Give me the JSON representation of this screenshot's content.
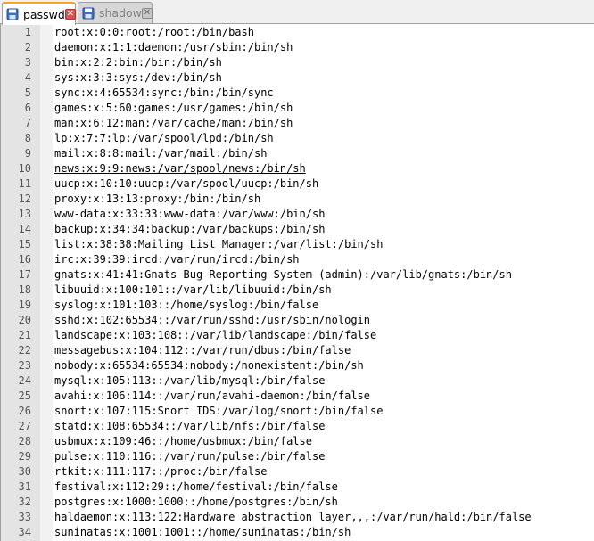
{
  "tabs": [
    {
      "label": "passwd",
      "active": true,
      "icon": "file-saved-icon"
    },
    {
      "label": "shadow",
      "active": false,
      "icon": "file-saved-icon"
    }
  ],
  "close_glyph": "✕",
  "colors": {
    "active_tab_accent": "#f5a623",
    "close_active": "#e05050",
    "gutter": "#e4e4e4",
    "text": "#000000"
  },
  "lines": [
    {
      "n": "1",
      "text": "root:x:0:0:root:/root:/bin/bash"
    },
    {
      "n": "2",
      "text": "daemon:x:1:1:daemon:/usr/sbin:/bin/sh"
    },
    {
      "n": "3",
      "text": "bin:x:2:2:bin:/bin:/bin/sh"
    },
    {
      "n": "4",
      "text": "sys:x:3:3:sys:/dev:/bin/sh"
    },
    {
      "n": "5",
      "text": "sync:x:4:65534:sync:/bin:/bin/sync"
    },
    {
      "n": "6",
      "text": "games:x:5:60:games:/usr/games:/bin/sh"
    },
    {
      "n": "7",
      "text": "man:x:6:12:man:/var/cache/man:/bin/sh"
    },
    {
      "n": "8",
      "text": "lp:x:7:7:lp:/var/spool/lpd:/bin/sh"
    },
    {
      "n": "9",
      "text": "mail:x:8:8:mail:/var/mail:/bin/sh"
    },
    {
      "n": "10",
      "text": "news:x:9:9:news:/var/spool/news:/bin/sh"
    },
    {
      "n": "11",
      "text": "uucp:x:10:10:uucp:/var/spool/uucp:/bin/sh"
    },
    {
      "n": "12",
      "text": "proxy:x:13:13:proxy:/bin:/bin/sh"
    },
    {
      "n": "13",
      "text": "www-data:x:33:33:www-data:/var/www:/bin/sh"
    },
    {
      "n": "14",
      "text": "backup:x:34:34:backup:/var/backups:/bin/sh"
    },
    {
      "n": "15",
      "text": "list:x:38:38:Mailing List Manager:/var/list:/bin/sh"
    },
    {
      "n": "16",
      "text": "irc:x:39:39:ircd:/var/run/ircd:/bin/sh"
    },
    {
      "n": "17",
      "text": "gnats:x:41:41:Gnats Bug-Reporting System (admin):/var/lib/gnats:/bin/sh"
    },
    {
      "n": "18",
      "text": "libuuid:x:100:101::/var/lib/libuuid:/bin/sh"
    },
    {
      "n": "19",
      "text": "syslog:x:101:103::/home/syslog:/bin/false"
    },
    {
      "n": "20",
      "text": "sshd:x:102:65534::/var/run/sshd:/usr/sbin/nologin"
    },
    {
      "n": "21",
      "text": "landscape:x:103:108::/var/lib/landscape:/bin/false"
    },
    {
      "n": "22",
      "text": "messagebus:x:104:112::/var/run/dbus:/bin/false"
    },
    {
      "n": "23",
      "text": "nobody:x:65534:65534:nobody:/nonexistent:/bin/sh"
    },
    {
      "n": "24",
      "text": "mysql:x:105:113::/var/lib/mysql:/bin/false"
    },
    {
      "n": "25",
      "text": "avahi:x:106:114::/var/run/avahi-daemon:/bin/false"
    },
    {
      "n": "26",
      "text": "snort:x:107:115:Snort IDS:/var/log/snort:/bin/false"
    },
    {
      "n": "27",
      "text": "statd:x:108:65534::/var/lib/nfs:/bin/false"
    },
    {
      "n": "28",
      "text": "usbmux:x:109:46::/home/usbmux:/bin/false"
    },
    {
      "n": "29",
      "text": "pulse:x:110:116::/var/run/pulse:/bin/false"
    },
    {
      "n": "30",
      "text": "rtkit:x:111:117::/proc:/bin/false"
    },
    {
      "n": "31",
      "text": "festival:x:112:29::/home/festival:/bin/false"
    },
    {
      "n": "32",
      "text": "postgres:x:1000:1000::/home/postgres:/bin/sh"
    },
    {
      "n": "33",
      "text": "haldaemon:x:113:122:Hardware abstraction layer,,,:/var/run/hald:/bin/false"
    },
    {
      "n": "34",
      "text": "suninatas:x:1001:1001::/home/suninatas:/bin/sh"
    }
  ],
  "caret_line": "10"
}
